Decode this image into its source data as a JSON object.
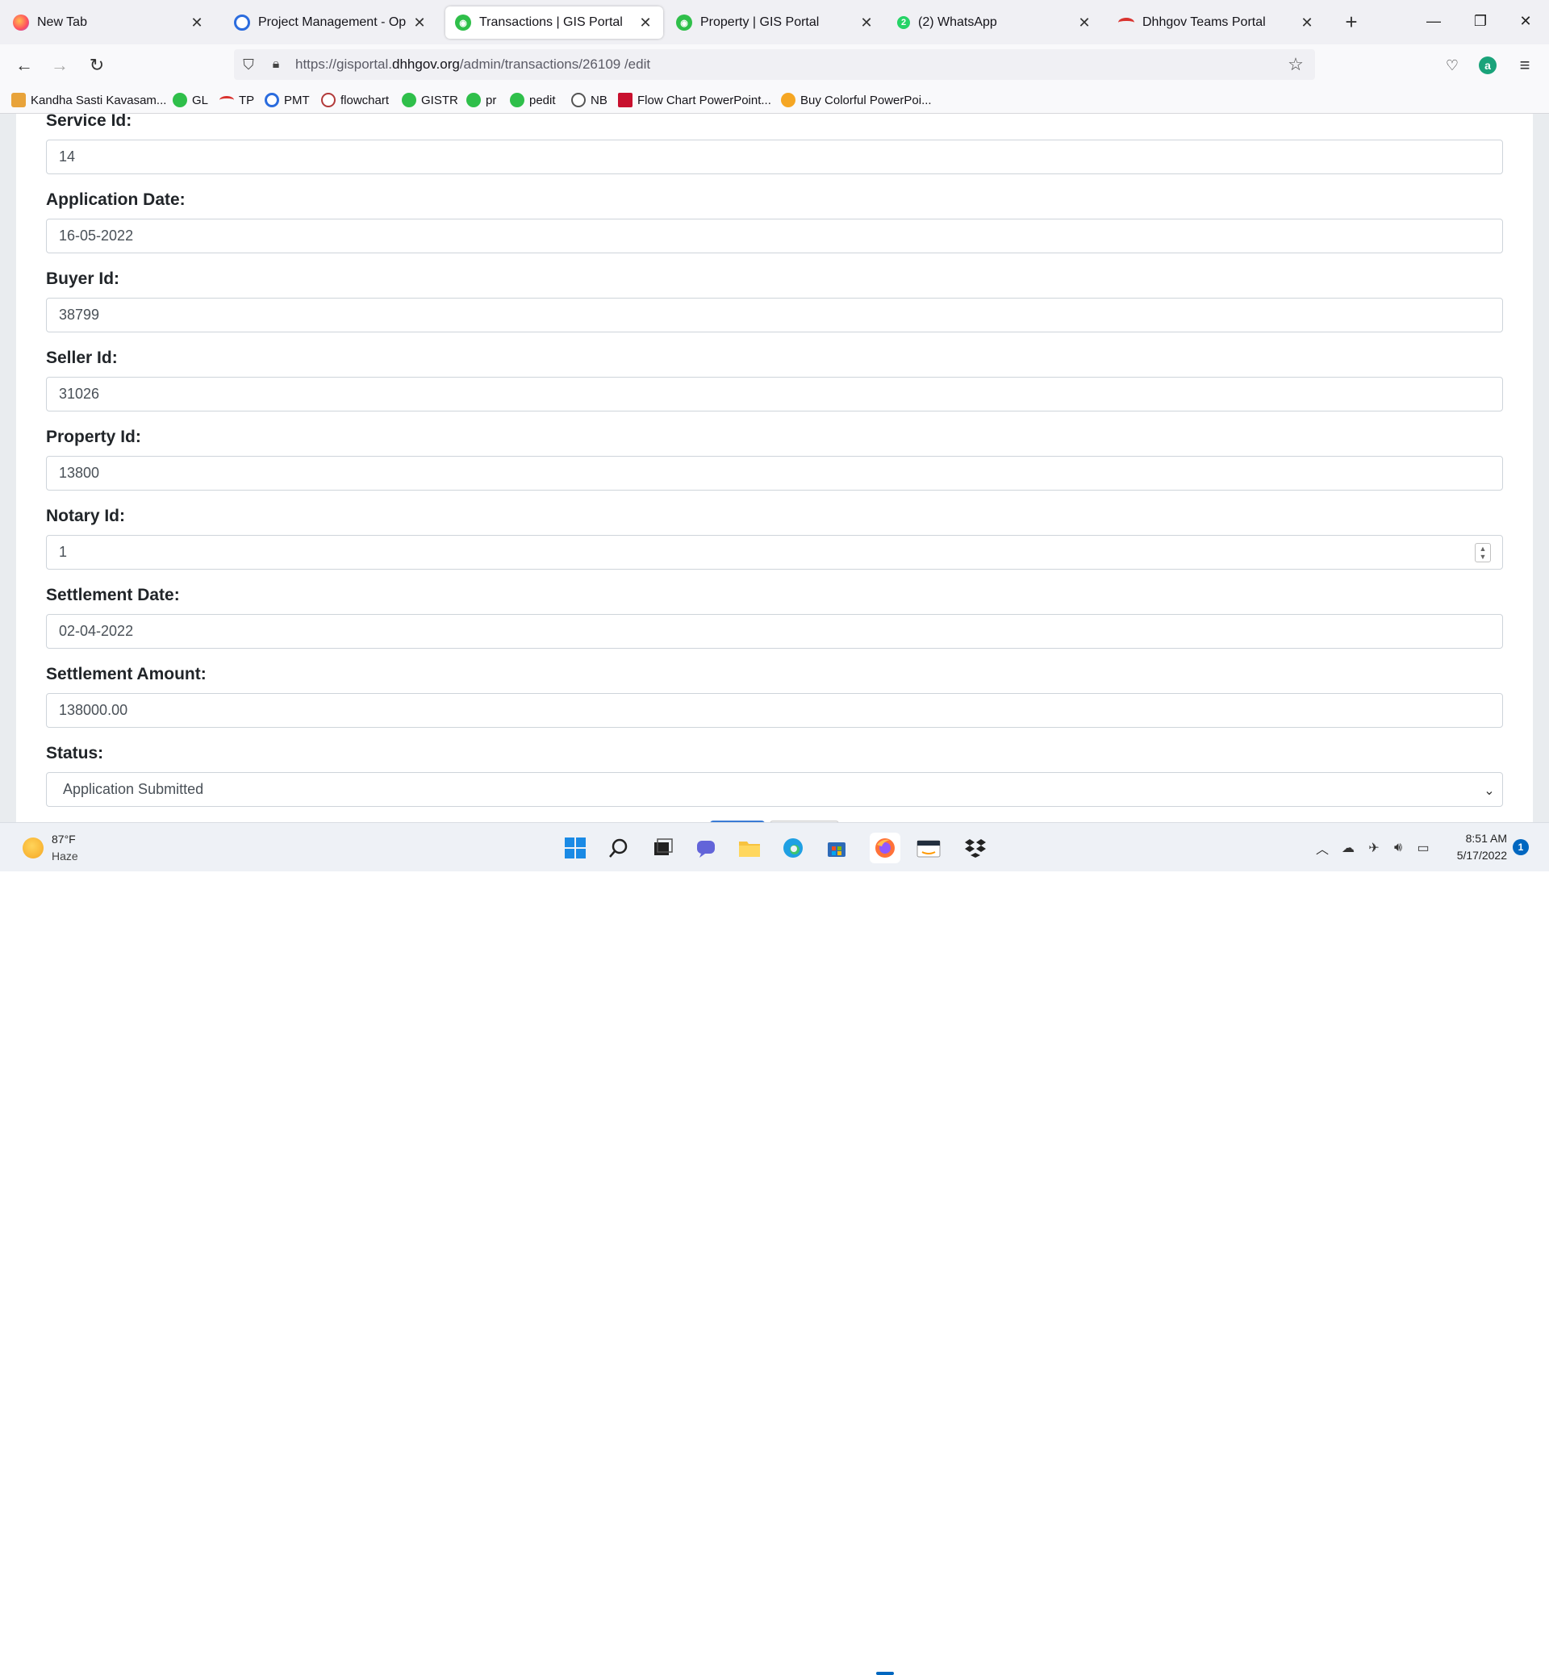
{
  "browser": {
    "tabs": [
      {
        "title": "New Tab",
        "icon": "firefox-icon",
        "icon_color": "#ff7139"
      },
      {
        "title": "Project Management - Operati",
        "icon": "pmt-icon",
        "icon_color": "#2b6cde"
      },
      {
        "title": "Transactions | GIS Portal",
        "icon": "gis-icon",
        "icon_color": "#2fbf4a"
      },
      {
        "title": "Property | GIS Portal",
        "icon": "gis-icon",
        "icon_color": "#2fbf4a"
      },
      {
        "title": "(2) WhatsApp",
        "icon": "whatsapp-icon",
        "icon_color": "#25d366",
        "badge": "2"
      },
      {
        "title": "Dhhgov Teams Portal",
        "icon": "teams-portal-icon",
        "icon_color": "#d9322e"
      }
    ],
    "active_tab_index": 2,
    "url": {
      "prefix": "https://gisportal.",
      "host": "dhhgov.org",
      "path": "/admin/transactions/26109 /edit"
    },
    "bookmarks": [
      {
        "label": "Kandha Sasti Kavasam...",
        "icon_color": "#e8a33a"
      },
      {
        "label": "GL",
        "icon_color": "#2fbf4a"
      },
      {
        "label": "TP",
        "icon_color": "#d9322e"
      },
      {
        "label": "PMT",
        "icon_color": "#2b6cde"
      },
      {
        "label": "flowchart",
        "icon_color": "#b23a3a"
      },
      {
        "label": "GISTR",
        "icon_color": "#2fbf4a"
      },
      {
        "label": "pr",
        "icon_color": "#2fbf4a"
      },
      {
        "label": "pedit",
        "icon_color": "#2fbf4a"
      },
      {
        "label": "NB",
        "icon_color": "#555555"
      },
      {
        "label": "Flow Chart PowerPoint...",
        "icon_color": "#c8102e"
      },
      {
        "label": "Buy Colorful PowerPoi...",
        "icon_color": "#f5a623"
      }
    ]
  },
  "form": {
    "fields": [
      {
        "label": "Service Id:",
        "value": "14",
        "type": "text"
      },
      {
        "label": "Application Date:",
        "value": "16-05-2022",
        "type": "text"
      },
      {
        "label": "Buyer Id:",
        "value": "38799",
        "type": "text"
      },
      {
        "label": "Seller Id:",
        "value": "31026",
        "type": "text"
      },
      {
        "label": "Property Id:",
        "value": "13800",
        "type": "text"
      },
      {
        "label": "Notary Id:",
        "value": "1",
        "type": "number"
      },
      {
        "label": "Settlement Date:",
        "value": "02-04-2022",
        "type": "text"
      },
      {
        "label": "Settlement Amount:",
        "value": "138000.00",
        "type": "text"
      },
      {
        "label": "Status:",
        "value": "Application Submitted",
        "type": "select"
      }
    ]
  },
  "taskbar": {
    "weather": {
      "temp": "87°F",
      "desc": "Haze"
    },
    "clock": {
      "time": "8:51 AM",
      "date": "5/17/2022"
    },
    "notifications": "1",
    "apps": [
      "windows-start-icon",
      "search-icon",
      "task-view-icon",
      "teams-chat-icon",
      "file-explorer-icon",
      "edge-icon",
      "store-icon",
      "firefox-icon",
      "amazon-icon",
      "dropbox-icon"
    ]
  },
  "colors": {
    "accent_blue": "#0067c0",
    "gis_green": "#2fbf4a",
    "label_text": "#212529",
    "input_border": "#ced4da"
  }
}
